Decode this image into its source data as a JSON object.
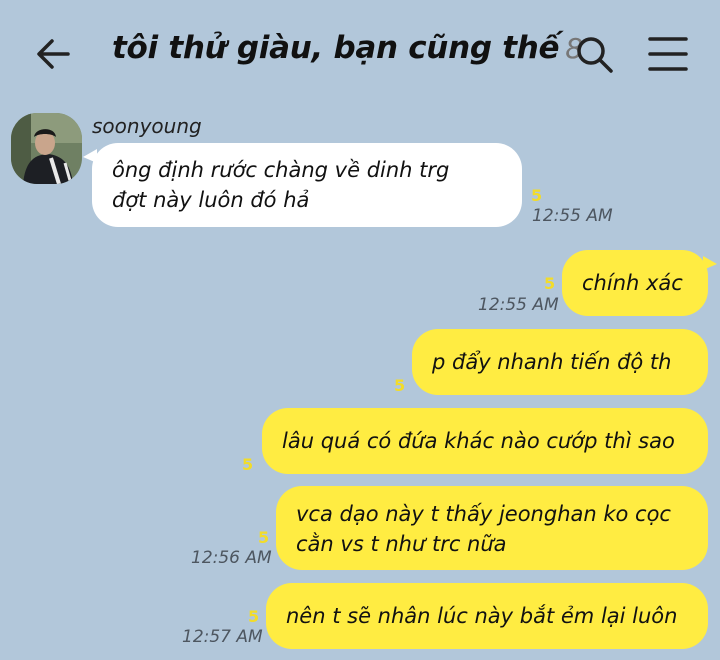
{
  "header": {
    "title": "tôi thử giàu, bạn cũng thế",
    "member_count": "8",
    "icons": {
      "back": "arrow-left-icon",
      "search": "search-icon",
      "menu": "hamburger-menu-icon"
    }
  },
  "colors": {
    "background": "#b2c7da",
    "outgoing_bubble": "#ffec42",
    "incoming_bubble": "#ffffff",
    "unread_count": "#f2dc2a"
  },
  "messages": [
    {
      "direction": "in",
      "sender": "soonyoung",
      "text_lines": [
        "ông định rước chàng về dinh trg",
        "đợt này luôn đó hả"
      ],
      "unread": "5",
      "time": "12:55 AM"
    },
    {
      "direction": "out",
      "text": "chính xác",
      "unread": "5",
      "time": "12:55 AM"
    },
    {
      "direction": "out",
      "text": "p đẩy nhanh tiến độ th",
      "unread": "5"
    },
    {
      "direction": "out",
      "text": "lâu quá có đứa khác nào cướp thì sao",
      "unread": "5"
    },
    {
      "direction": "out",
      "text_lines": [
        "vca dạo này t thấy jeonghan ko cọc",
        "cằn vs t như trc nữa"
      ],
      "unread": "5",
      "time": "12:56 AM"
    },
    {
      "direction": "out",
      "text": "nên t sẽ nhân lúc này bắt ẻm lại luôn",
      "unread": "5",
      "time": "12:57 AM"
    }
  ]
}
